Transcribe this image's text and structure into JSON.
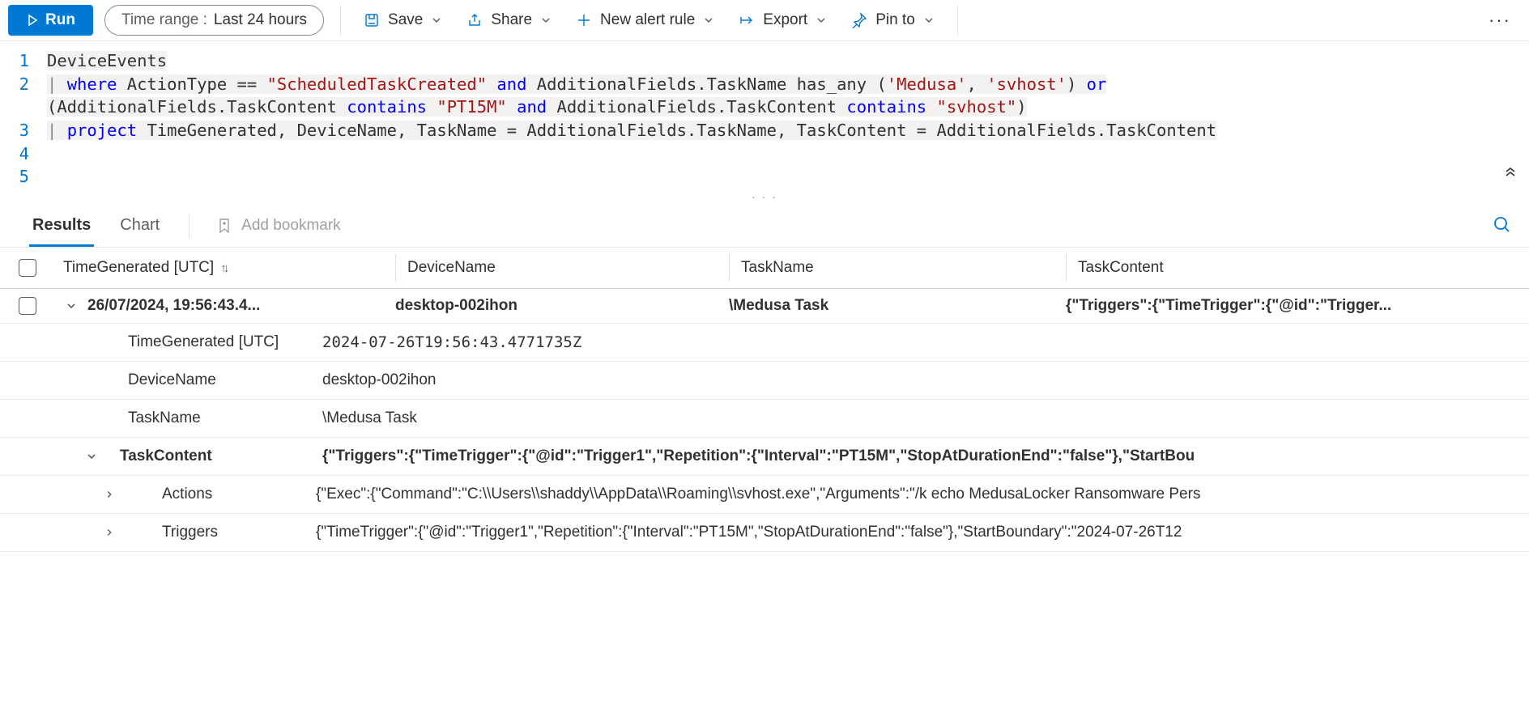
{
  "toolbar": {
    "run_label": "Run",
    "timerange_label": "Time range :",
    "timerange_value": "Last 24 hours",
    "save_label": "Save",
    "share_label": "Share",
    "new_alert_label": "New alert rule",
    "export_label": "Export",
    "pin_label": "Pin to"
  },
  "editor": {
    "lines": [
      "1",
      "2",
      "3",
      "4",
      "5"
    ],
    "tokens": {
      "l1_t1": "DeviceEvents",
      "l2_pipe": "|",
      "l2_kw1": "where",
      "l2_id1": "ActionType",
      "l2_op1": "==",
      "l2_str1": "\"ScheduledTaskCreated\"",
      "l2_kw2": "and",
      "l2_id2": "AdditionalFields.TaskName",
      "l2_id3": "has_any",
      "l2_paren1": "(",
      "l2_str2": "'Medusa'",
      "l2_comma": ",",
      "l2_str3": "'svhost'",
      "l2_paren2": ")",
      "l2_kw3": "or",
      "l2b_paren1": "(",
      "l2b_id1": "AdditionalFields.TaskContent",
      "l2b_kw1": "contains",
      "l2b_str1": "\"PT15M\"",
      "l2b_kw2": "and",
      "l2b_id2": "AdditionalFields.TaskContent",
      "l2b_kw3": "contains",
      "l2b_str2": "\"svhost\"",
      "l2b_paren2": ")",
      "l3_pipe": "|",
      "l3_kw1": "project",
      "l3_rest": "TimeGenerated, DeviceName, TaskName = AdditionalFields.TaskName, TaskContent = AdditionalFields.TaskContent"
    }
  },
  "tabs": {
    "results": "Results",
    "chart": "Chart",
    "bookmark": "Add bookmark"
  },
  "columns": {
    "time": "TimeGenerated [UTC]",
    "device": "DeviceName",
    "taskname": "TaskName",
    "taskcontent": "TaskContent"
  },
  "row": {
    "time_short": "26/07/2024, 19:56:43.4...",
    "device": "desktop-002ihon",
    "taskname": "\\Medusa Task",
    "taskcontent_short": "{\"Triggers\":{\"TimeTrigger\":{\"@id\":\"Trigger...",
    "details": {
      "time_key": "TimeGenerated [UTC]",
      "time_val": "2024-07-26T19:56:43.4771735Z",
      "device_key": "DeviceName",
      "device_val": "desktop-002ihon",
      "taskname_key": "TaskName",
      "taskname_val": "\\Medusa Task",
      "taskcontent_key": "TaskContent",
      "taskcontent_val": "{\"Triggers\":{\"TimeTrigger\":{\"@id\":\"Trigger1\",\"Repetition\":{\"Interval\":\"PT15M\",\"StopAtDurationEnd\":\"false\"},\"StartBou",
      "actions_key": "Actions",
      "actions_val": "{\"Exec\":{\"Command\":\"C:\\\\Users\\\\shaddy\\\\AppData\\\\Roaming\\\\svhost.exe\",\"Arguments\":\"/k echo MedusaLocker Ransomware Pers",
      "triggers_key": "Triggers",
      "triggers_val": "{\"TimeTrigger\":{\"@id\":\"Trigger1\",\"Repetition\":{\"Interval\":\"PT15M\",\"StopAtDurationEnd\":\"false\"},\"StartBoundary\":\"2024-07-26T12"
    }
  }
}
